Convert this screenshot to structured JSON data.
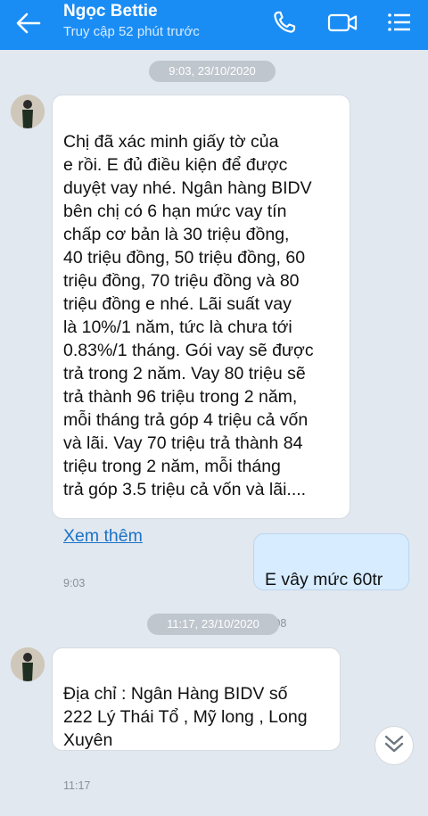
{
  "header": {
    "contact_name": "Ngọc Bettie",
    "last_seen": "Truy cập 52 phút trước",
    "icons": [
      "back-arrow-icon",
      "phone-icon",
      "video-camera-icon",
      "menu-list-icon"
    ],
    "accent_color": "#1a8df5"
  },
  "messages": {
    "group1_time": "9:03, 23/10/2020",
    "msg1": {
      "text": "Chị đã xác minh giấy tờ của\ne rồi. E đủ điều kiện để được\nduyệt vay nhé. Ngân hàng BIDV\nbên chị có 6 hạn mức vay tín\nchấp cơ bản là 30 triệu đồng,\n40 triệu đồng, 50 triệu đồng, 60\ntriệu đồng, 70 triệu đồng và 80\ntriệu đồng e nhé. Lãi suất vay\nlà 10%/1 năm, tức là chưa tới\n0.83%/1 tháng. Gói vay sẽ được\ntrả trong 2 năm. Vay 80 triệu sẽ\ntrả thành 96 triệu trong 2 năm,\nmỗi tháng trả góp 4 triệu cả vốn\nvà lãi. Vay 70 triệu trả thành 84\ntriệu trong 2 năm, mỗi tháng\ntrả góp 3.5 triệu cả vốn và lãi....",
      "more": "Xem thêm",
      "time": "9:03"
    },
    "msg2": {
      "text": "E vây mức 60tr",
      "time": "9:08"
    },
    "group2_time": "11:17, 23/10/2020",
    "msg3": {
      "text": "Địa chỉ :  Ngân Hàng BIDV số\n222 Lý Thái Tổ , Mỹ long , Long\nXuyên",
      "time": "11:17"
    }
  },
  "scroll_down_icon": "double-chevron-down-icon"
}
